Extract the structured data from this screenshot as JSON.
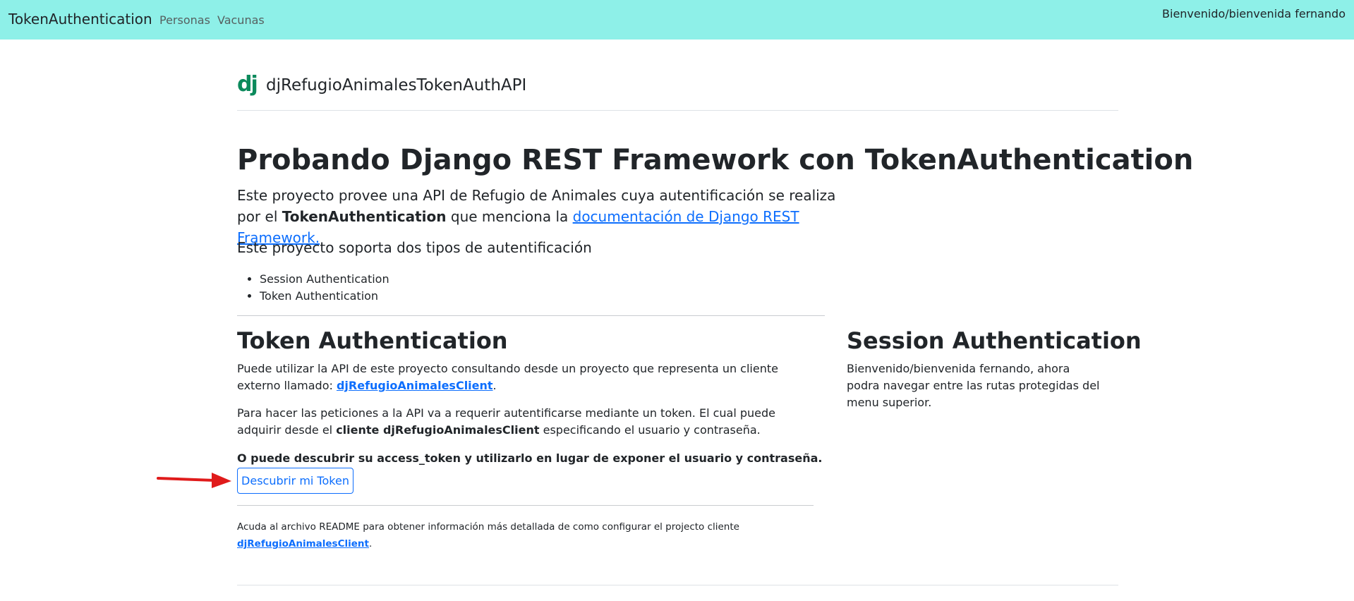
{
  "navbar": {
    "brand": "TokenAuthentication",
    "links": [
      "Personas",
      "Vacunas"
    ],
    "user_greeting": "Bienvenido/bienvenida fernando"
  },
  "header": {
    "logo_text": "dj",
    "site_title": "djRefugioAnimalesTokenAuthAPI"
  },
  "intro": {
    "title": "Probando Django REST Framework con TokenAuthentication",
    "lead_part1": "Este proyecto provee una API de Refugio de Animales cuya autentificación se realiza por el ",
    "lead_bold": "TokenAuthentication",
    "lead_part2": " que menciona la ",
    "lead_link": "documentación de Django REST Framework.",
    "support_text": "Este proyecto soporta dos tipos de autentificación",
    "auth_types": [
      "Session Authentication",
      "Token Authentication"
    ]
  },
  "token_auth": {
    "title": "Token Authentication",
    "p1_part1": "Puede utilizar la API de este proyecto consultando desde un proyecto que representa un cliente externo llamado: ",
    "p1_link": "djRefugioAnimalesClient",
    "p1_part2": ".",
    "p2_part1": "Para hacer las peticiones a la API va a requerir autentificarse mediante un token. El cual puede adquirir desde el ",
    "p2_bold": "cliente djRefugioAnimalesClient",
    "p2_part2": " especificando el usuario y contraseña.",
    "p3_bold": "O puede descubrir su access_token y utilizarlo en lugar de exponer el usuario y contraseña.",
    "button_label": "Descubrir mi Token",
    "readme_part1": "Acuda al archivo README para obtener información más detallada de como configurar el projecto cliente ",
    "readme_link": "djRefugioAnimalesClient",
    "readme_part2": "."
  },
  "session_auth": {
    "title": "Session Authentication",
    "text": "Bienvenido/bienvenida fernando, ahora podra navegar entre las rutas protegidas del menu superior."
  },
  "colors": {
    "navbar_bg": "#8ef0e8",
    "link": "#0d6efd",
    "logo": "#0c8a5c",
    "arrow": "#e01b1b"
  },
  "icons": {
    "logo": "django-logo-icon",
    "annotation": "red-arrow-icon"
  }
}
